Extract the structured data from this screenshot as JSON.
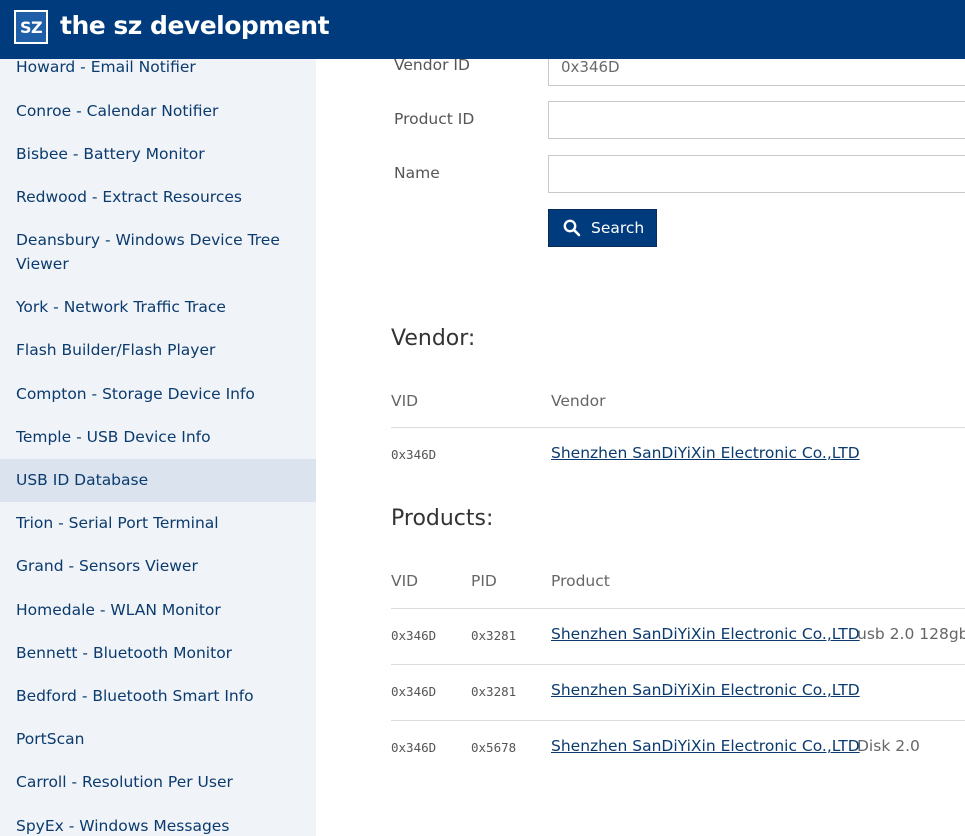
{
  "header": {
    "logo_text": "SZ",
    "title": "the sz development"
  },
  "sidebar": {
    "items": [
      {
        "label": "Howard - Email Notifier"
      },
      {
        "label": "Conroe - Calendar Notifier"
      },
      {
        "label": "Bisbee - Battery Monitor"
      },
      {
        "label": "Redwood - Extract Resources"
      },
      {
        "label": "Deansbury - Windows Device Tree Viewer"
      },
      {
        "label": "York - Network Traffic Trace"
      },
      {
        "label": "Flash Builder/Flash Player"
      },
      {
        "label": "Compton - Storage Device Info"
      },
      {
        "label": "Temple - USB Device Info"
      },
      {
        "label": "USB ID Database",
        "active": true
      },
      {
        "label": "Trion - Serial Port Terminal"
      },
      {
        "label": "Grand - Sensors Viewer"
      },
      {
        "label": "Homedale - WLAN Monitor"
      },
      {
        "label": "Bennett - Bluetooth Monitor"
      },
      {
        "label": "Bedford - Bluetooth Smart Info"
      },
      {
        "label": "PortScan"
      },
      {
        "label": "Carroll - Resolution Per User"
      },
      {
        "label": "SpyEx - Windows Messages"
      }
    ]
  },
  "form": {
    "vendor_id_label": "Vendor ID",
    "vendor_id_value": "0x346D",
    "product_id_label": "Product ID",
    "product_id_value": "",
    "name_label": "Name",
    "name_value": "",
    "search_label": "Search"
  },
  "vendor_section": {
    "title": "Vendor:",
    "columns": {
      "vid": "VID",
      "vendor": "Vendor"
    },
    "rows": [
      {
        "vid": "0x346D",
        "vendor": "Shenzhen SanDiYiXin Electronic Co.,LTD"
      }
    ]
  },
  "products_section": {
    "title": "Products:",
    "columns": {
      "vid": "VID",
      "pid": "PID",
      "product": "Product"
    },
    "rows": [
      {
        "vid": "0x346D",
        "pid": "0x3281",
        "vendor": "Shenzhen SanDiYiXin Electronic Co.,LTD",
        "product": "usb 2.0 128gb"
      },
      {
        "vid": "0x346D",
        "pid": "0x3281",
        "vendor": "Shenzhen SanDiYiXin Electronic Co.,LTD",
        "product": ""
      },
      {
        "vid": "0x346D",
        "pid": "0x5678",
        "vendor": "Shenzhen SanDiYiXin Electronic Co.,LTD",
        "product": "Disk 2.0"
      }
    ]
  },
  "colors": {
    "header": "#003c7d",
    "sidebar_bg": "#f0f3f7",
    "sidebar_active": "#dbe4ee",
    "link": "#0b3b6e"
  },
  "icons": {
    "search_button": "search-icon"
  }
}
